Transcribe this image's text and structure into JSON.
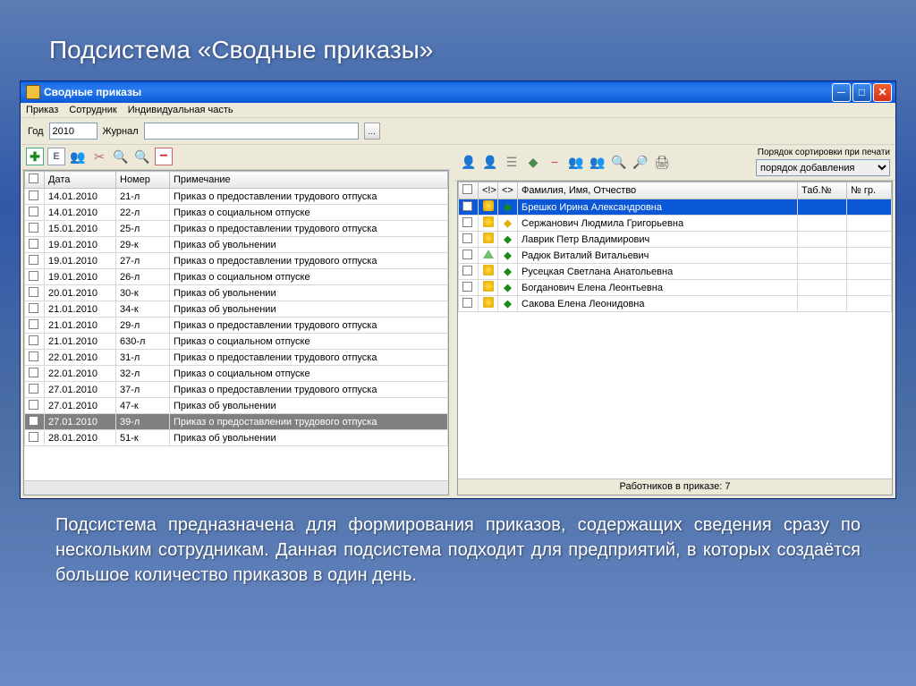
{
  "slide": {
    "title": "Подсистема «Сводные приказы»",
    "description": "Подсистема предназначена для формирования приказов, содержащих сведения сразу по нескольким сотрудникам. Данная подсистема подходит для предприятий, в которых создаётся большое количество приказов в один день."
  },
  "window": {
    "title": "Сводные приказы",
    "menu": [
      "Приказ",
      "Сотрудник",
      "Индивидуальная часть"
    ],
    "filter": {
      "year_label": "Год",
      "year_value": "2010",
      "journal_label": "Журнал",
      "journal_value": ""
    }
  },
  "left": {
    "headers": {
      "col1": "Дата",
      "col2": "Номер",
      "col3": "Примечание"
    },
    "rows": [
      {
        "date": "14.01.2010",
        "num": "21-л",
        "note": "Приказ о предоставлении трудового отпуска"
      },
      {
        "date": "14.01.2010",
        "num": "22-л",
        "note": "Приказ о социальном отпуске"
      },
      {
        "date": "15.01.2010",
        "num": "25-л",
        "note": "Приказ о предоставлении трудового отпуска"
      },
      {
        "date": "19.01.2010",
        "num": "29-к",
        "note": "Приказ об увольнении"
      },
      {
        "date": "19.01.2010",
        "num": "27-л",
        "note": "Приказ о предоставлении трудового отпуска"
      },
      {
        "date": "19.01.2010",
        "num": "26-л",
        "note": "Приказ о социальном отпуске"
      },
      {
        "date": "20.01.2010",
        "num": "30-к",
        "note": "Приказ об увольнении"
      },
      {
        "date": "21.01.2010",
        "num": "34-к",
        "note": "Приказ об увольнении"
      },
      {
        "date": "21.01.2010",
        "num": "29-л",
        "note": "Приказ о предоставлении трудового отпуска"
      },
      {
        "date": "21.01.2010",
        "num": "630-л",
        "note": "Приказ о социальном отпуске"
      },
      {
        "date": "22.01.2010",
        "num": "31-л",
        "note": "Приказ о предоставлении трудового отпуска"
      },
      {
        "date": "22.01.2010",
        "num": "32-л",
        "note": "Приказ о социальном отпуске"
      },
      {
        "date": "27.01.2010",
        "num": "37-л",
        "note": "Приказ о предоставлении трудового отпуска"
      },
      {
        "date": "27.01.2010",
        "num": "47-к",
        "note": "Приказ об увольнении"
      },
      {
        "date": "27.01.2010",
        "num": "39-л",
        "note": "Приказ о предоставлении трудового отпуска",
        "selected": true
      },
      {
        "date": "28.01.2010",
        "num": "51-к",
        "note": "Приказ об увольнении"
      }
    ]
  },
  "right": {
    "sort_label": "Порядок сортировки при печати",
    "sort_value": "порядок добавления",
    "headers": {
      "col_fio": "Фамилия, Имя, Отчество",
      "col_tab": "Таб.№",
      "col_gr": "№ гр."
    },
    "rows": [
      {
        "fio": "Брешко Ирина Александровна",
        "icon": "yellow",
        "mark": "green",
        "selected": true
      },
      {
        "fio": "Сержанович Людмила Григорьевна",
        "icon": "yellow",
        "mark": "yellow"
      },
      {
        "fio": "Лаврик Петр Владимирович",
        "icon": "yellow",
        "mark": "green"
      },
      {
        "fio": "Радюк Виталий Витальевич",
        "icon": "tri",
        "mark": "green"
      },
      {
        "fio": "Русецкая Светлана Анатольевна",
        "icon": "yellow",
        "mark": "green"
      },
      {
        "fio": "Богданович Елена Леонтьевна",
        "icon": "yellow",
        "mark": "green"
      },
      {
        "fio": "Сакова Елена Леонидовна",
        "icon": "yellow",
        "mark": "green"
      }
    ],
    "status": "Работников в приказе: 7"
  }
}
